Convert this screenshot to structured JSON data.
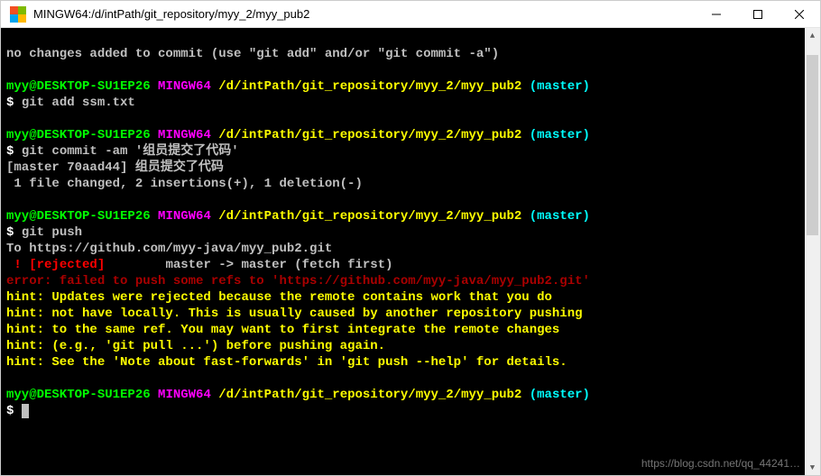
{
  "window": {
    "title": "MINGW64:/d/intPath/git_repository/myy_2/myy_pub2"
  },
  "prompt": {
    "user_host": "myy@DESKTOP-SU1EP26",
    "env": "MINGW64",
    "path": "/d/intPath/git_repository/myy_2/myy_pub2",
    "branch": "(master)",
    "symbol": "$ "
  },
  "lines": {
    "no_changes": "no changes added to commit (use \"git add\" and/or \"git commit -a\")",
    "cmd_add": "git add ssm.txt",
    "cmd_commit": "git commit -am '组员提交了代码'",
    "commit_out1": "[master 70aad44] 组员提交了代码",
    "commit_out2": " 1 file changed, 2 insertions(+), 1 deletion(-)",
    "cmd_push": "git push",
    "push_to": "To https://github.com/myy-java/myy_pub2.git",
    "rejected_bang": " ! ",
    "rejected_label": "[rejected]       ",
    "rejected_rest": " master -> master (fetch first)",
    "error": "error: failed to push some refs to 'https://github.com/myy-java/myy_pub2.git'",
    "hint1": "hint: Updates were rejected because the remote contains work that you do",
    "hint2": "hint: not have locally. This is usually caused by another repository pushing",
    "hint3": "hint: to the same ref. You may want to first integrate the remote changes",
    "hint4": "hint: (e.g., 'git pull ...') before pushing again.",
    "hint5": "hint: See the 'Note about fast-forwards' in 'git push --help' for details."
  },
  "watermark": "https://blog.csdn.net/qq_44241…"
}
